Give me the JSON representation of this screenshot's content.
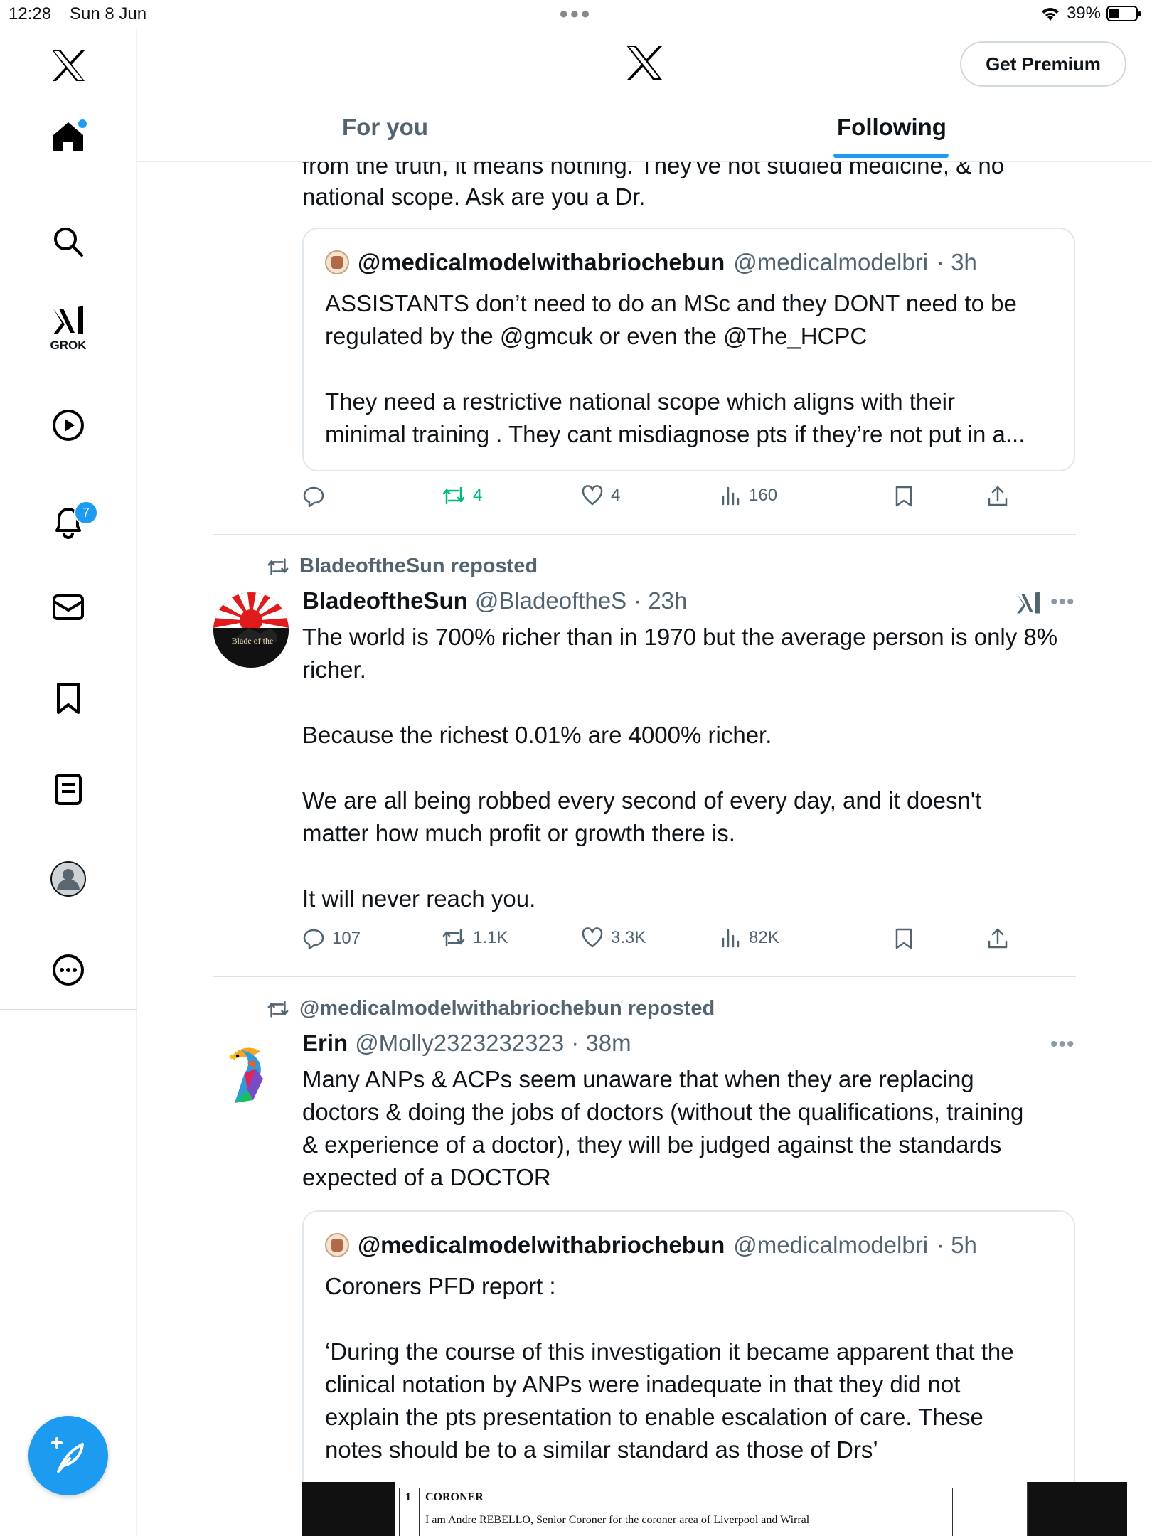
{
  "status_bar": {
    "time": "12:28",
    "date": "Sun 8 Jun",
    "battery": "39%"
  },
  "sidebar": {
    "items": [
      {
        "icon": "x-logo-icon"
      },
      {
        "icon": "home-icon"
      },
      {
        "icon": "search-icon"
      },
      {
        "icon": "grok-icon",
        "label": "GROK"
      },
      {
        "icon": "play-icon"
      },
      {
        "icon": "bell-icon",
        "badge": "7"
      },
      {
        "icon": "mail-icon"
      },
      {
        "icon": "bookmark-icon"
      },
      {
        "icon": "list-icon"
      },
      {
        "icon": "profile-icon"
      },
      {
        "icon": "more-icon"
      }
    ],
    "accent": "#1d9bf0"
  },
  "header": {
    "premium_label": "Get Premium",
    "tabs": [
      {
        "label": "For you",
        "active": false
      },
      {
        "label": "Following",
        "active": true
      }
    ]
  },
  "feed": {
    "tweet1": {
      "text_cut": "from the truth, it means nothing. They've not studied medicine, & no",
      "text_tail": "national scope. Ask are you a Dr.",
      "quote": {
        "name": "@medicalmodelwithabriochebun",
        "handle": "@medicalmodelbri",
        "time": "· 3h",
        "lines": [
          "ASSISTANTS don’t need to do an MSc and they DONT need to be",
          "regulated by the @gmcuk or even the @The_HCPC",
          "",
          "They need a restrictive national scope which aligns with their",
          "minimal training . They cant misdiagnose pts  if they’re not put in a..."
        ]
      },
      "actions": {
        "replies": "",
        "reposts": "4",
        "likes": "4",
        "views": "160"
      }
    },
    "tweet2": {
      "repost_by": "BladeoftheSun reposted",
      "name": "BladeoftheSun",
      "handle": "@BladeoftheS",
      "time": "· 23h",
      "avatar_text": "Blade of the",
      "lines": [
        "The world is 700% richer than in 1970 but the average person is only 8%",
        "richer.",
        "",
        "Because the richest 0.01% are 4000% richer.",
        "",
        "We are all being robbed every second of every day, and it doesn't",
        "matter how much profit or growth there is.",
        "",
        "It will never reach you."
      ],
      "actions": {
        "replies": "107",
        "reposts": "1.1K",
        "likes": "3.3K",
        "views": "82K"
      }
    },
    "tweet3": {
      "repost_by": "@medicalmodelwithabriochebun reposted",
      "name": "Erin",
      "handle": "@Molly2323232323",
      "time": "· 38m",
      "lines": [
        "Many ANPs & ACPs seem unaware that when they are replacing",
        "doctors & doing the jobs of doctors (without the qualifications, training",
        "& experience of a doctor), they will be judged against the standards",
        "expected of a DOCTOR"
      ],
      "quote": {
        "name": "@medicalmodelwithabriochebun",
        "handle": "@medicalmodelbri",
        "time": "· 5h",
        "lines": [
          "Coroners PFD report :",
          "",
          "‘During the course of this investigation it became apparent that the",
          "clinical notation by ANPs were inadequate in that they did not",
          "explain the pts presentation to enable escalation of care. These",
          "notes should be to a similar standard as those of Drs’"
        ],
        "doc": {
          "num": "1",
          "heading": "CORONER",
          "text": "I am Andre REBELLO, Senior Coroner for the coroner area of Liverpool and Wirral"
        }
      }
    }
  }
}
